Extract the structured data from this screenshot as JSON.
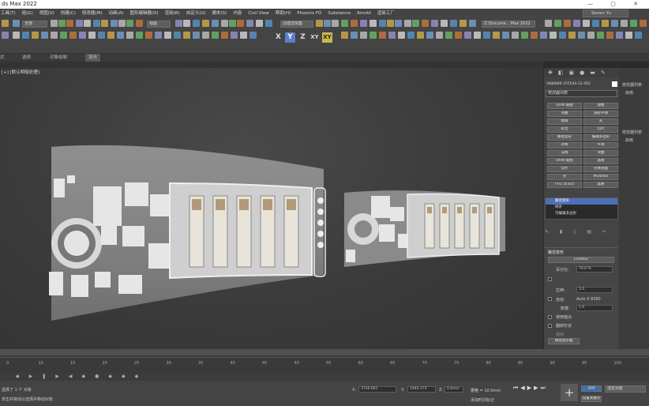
{
  "window": {
    "title": "ds Max 2022"
  },
  "menu": [
    "工具(T)",
    "组(G)",
    "视图(V)",
    "创建(C)",
    "修改器(M)",
    "动画(A)",
    "图形编辑器(D)",
    "渲染(R)",
    "自定义(U)",
    "脚本(S)",
    "内容",
    "Civil View",
    "帮助(H)",
    "Phoenix FD",
    "Substance",
    "Arnold",
    "渲染工厂"
  ],
  "user": "Seven Yu",
  "toolbar": {
    "selection_filter": "全部",
    "view": "视图",
    "selection_set": "创建选择集",
    "project_path": "Z:\\Docume... Max 2022"
  },
  "axes": [
    "X",
    "Y",
    "Z",
    "XY",
    "XY"
  ],
  "ribbon": [
    "式",
    "选择",
    "对象绘制",
    "填充"
  ],
  "viewport": {
    "label": "[+] [默认明暗处理]"
  },
  "command_panel": {
    "object_name": "UNJ6866-155544-12-402",
    "modifier_list": "修改器列表",
    "buttons": [
      [
        "UVW 贴图",
        "镜像"
      ],
      [
        "弯曲",
        "涡轮平滑"
      ],
      [
        "倒角",
        "壳"
      ],
      [
        "挤出",
        "切片"
      ],
      [
        "路径变形",
        "编辑多边形"
      ],
      [
        "对称",
        "平滑"
      ],
      [
        "法线",
        "弯曲"
      ],
      [
        "UVW 贴图",
        "晶格"
      ],
      [
        "切片",
        "壳体剖面"
      ],
      [
        "壳",
        "MultiRes"
      ],
      [
        "FFD 3x3x3",
        "晶格"
      ]
    ],
    "stack": [
      "路径变形",
      "样条",
      "可编辑多边形"
    ],
    "rollout_title": "路径变形",
    "pick_path": "Line002",
    "percent_label": "百分比:",
    "percent_value": "70.0 %",
    "stretch_label": "拉伸:",
    "stretch_value": "1.0",
    "auto_label": "自动",
    "auto_value": "Auto 0.9380",
    "count_label": "数量:",
    "count_value": "1.0",
    "opts": [
      "使用轴点",
      "翻转形状",
      "偏移:"
    ],
    "move_btn": "路径变形轴"
  },
  "far_panel": {
    "items": [
      "修改器列表",
      "启用",
      "修改器列表",
      "启用"
    ]
  },
  "timeline": {
    "ticks": [
      "0",
      "10",
      "15",
      "20",
      "25",
      "30",
      "35",
      "40",
      "45",
      "50",
      "55",
      "60",
      "65",
      "70",
      "75",
      "80",
      "85",
      "90",
      "95",
      "100"
    ]
  },
  "status": {
    "line1": "选择了 1 个 对象",
    "line2": "单击并拖动以选择并移动对象",
    "x_label": "X:",
    "x_value": "3730.661",
    "y_label": "Y:",
    "y_value": "1940.173",
    "z_label": "Z:",
    "z_value": "0.0mm",
    "grid": "栅格 = 10.0mm",
    "autokey": "自动",
    "setkey": "设置关键点",
    "filter": "选定对象",
    "time_tag": "添加时间标记"
  }
}
